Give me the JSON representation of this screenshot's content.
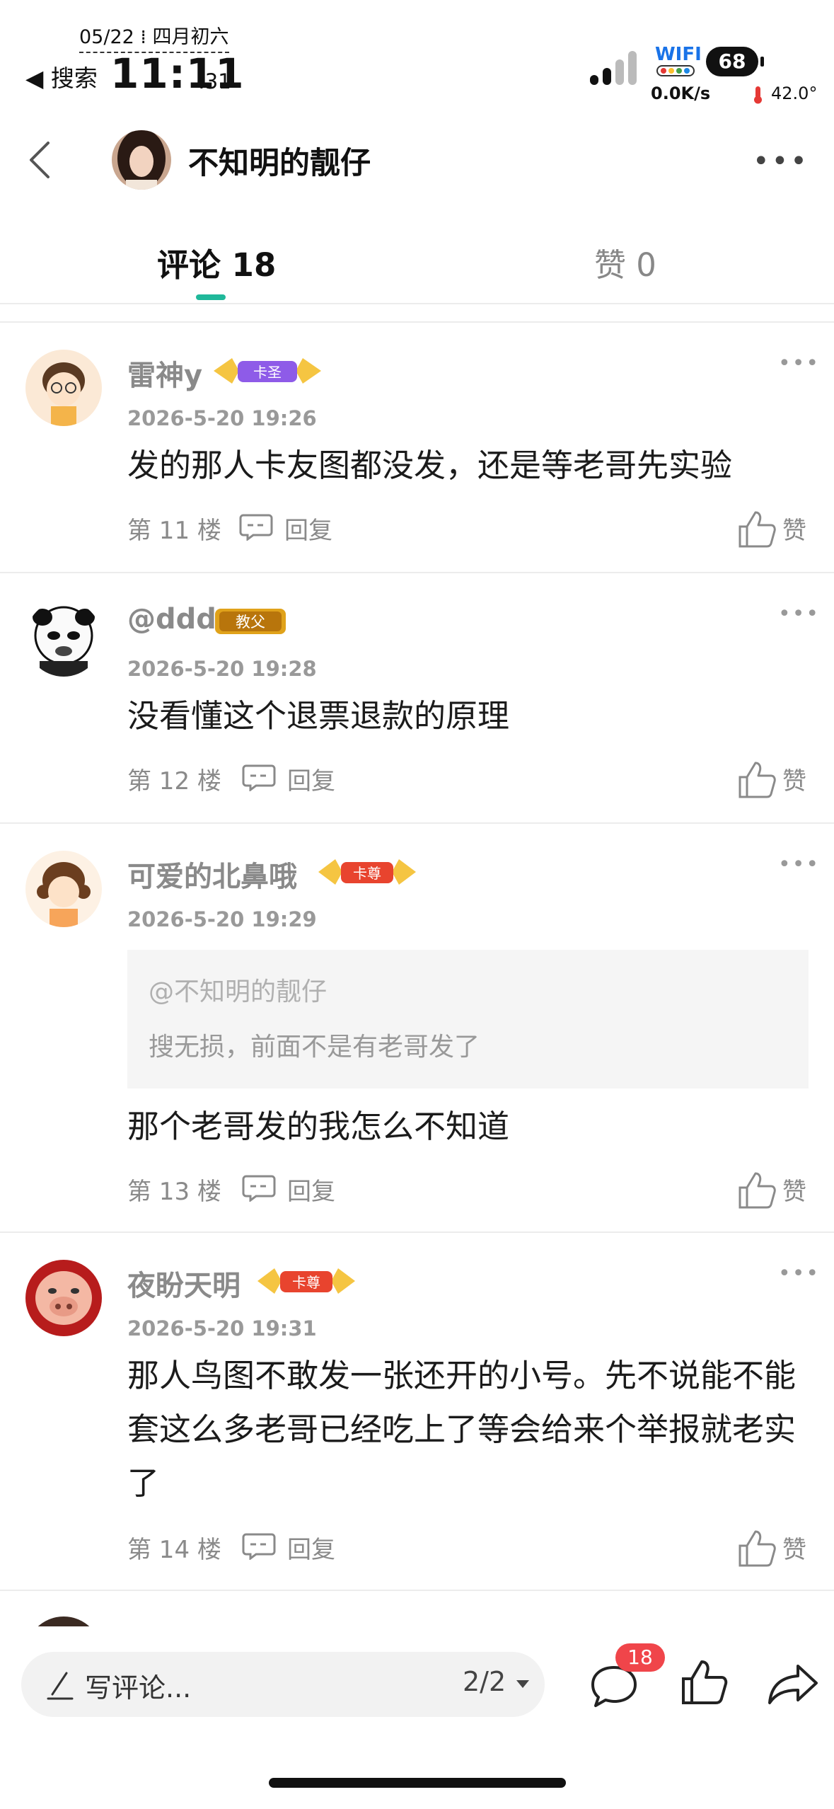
{
  "status_bar": {
    "date": "05/22 ⁞ 四月初六",
    "back_label": "◀ 搜索",
    "time": "11:11",
    "seconds": ":31",
    "wifi_label": "WIFI",
    "battery": "68",
    "net_speed": "0.0K/s",
    "temperature": "42.0°"
  },
  "header": {
    "title": "不知明的靓仔"
  },
  "tabs": [
    {
      "label": "评论 18"
    },
    {
      "label": "赞 0"
    }
  ],
  "comments": [
    {
      "user": "雷神y",
      "badge": "卡圣",
      "time": "2026-5-20 19:26",
      "text": "发的那人卡友图都没发，还是等老哥先实验",
      "floor": "第 11 楼",
      "reply": "回复",
      "like": "赞"
    },
    {
      "user": "@ddd",
      "badge": "教父",
      "time": "2026-5-20 19:28",
      "text": "没看懂这个退票退款的原理",
      "floor": "第 12 楼",
      "reply": "回复",
      "like": "赞"
    },
    {
      "user": "可爱的北鼻哦",
      "badge": "卡尊",
      "time": "2026-5-20 19:29",
      "quote_user": "@不知明的靓仔",
      "quote_text": "搜无损，前面不是有老哥发了",
      "text": "那个老哥发的我怎么不知道",
      "floor": "第 13 楼",
      "reply": "回复",
      "like": "赞"
    },
    {
      "user": "夜盼天明",
      "badge": "卡尊",
      "time": "2026-5-20 19:31",
      "text": "那人鸟图不敢发一张还开的小号。先不说能不能套这么多老哥已经吃上了等会给来个举报就老实了",
      "floor": "第 14 楼",
      "reply": "回复",
      "like": "赞"
    }
  ],
  "bottom_bar": {
    "placeholder": "写评论...",
    "page": "2/2",
    "comment_count": "18"
  },
  "colors": {
    "accent": "#1fb89a",
    "badge_red": "#f0454a",
    "name_gray": "#8a8a8a"
  }
}
